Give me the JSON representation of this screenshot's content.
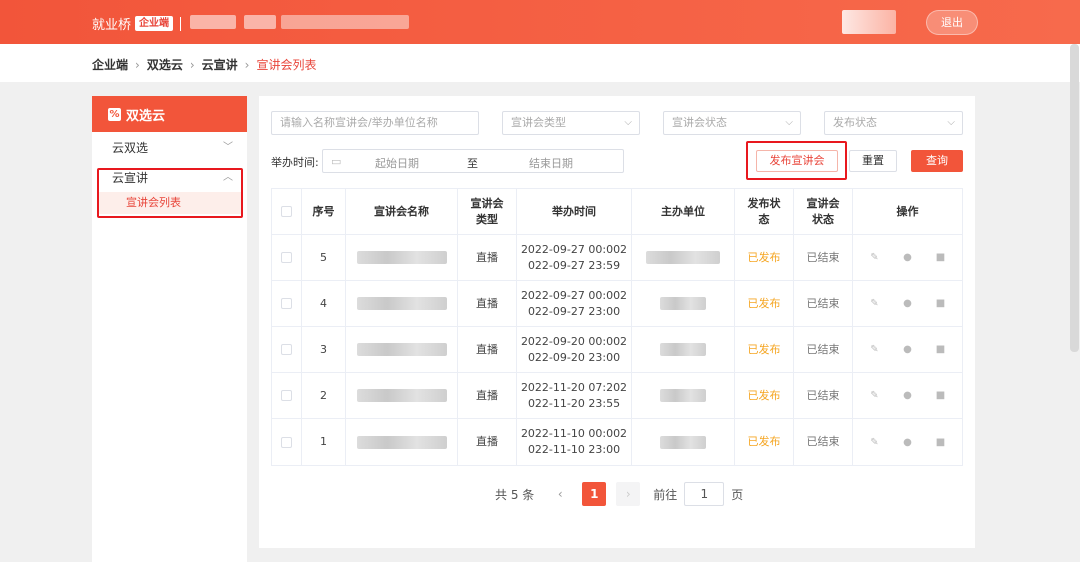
{
  "header": {
    "brand": "就业桥",
    "brand_tag": "企业端",
    "logout_label": "退出"
  },
  "breadcrumb": {
    "items": [
      "企业端",
      "双选云",
      "云宣讲"
    ],
    "current": "宣讲会列表"
  },
  "sidebar": {
    "title": "双选云",
    "logo_glyph": "%",
    "items": [
      {
        "label": "云双选",
        "chevron": "﹀"
      },
      {
        "label": "云宣讲",
        "chevron": "︿"
      }
    ],
    "sub_item": "宣讲会列表"
  },
  "filters": {
    "search_placeholder": "请输入名称宣讲会/举办单位名称",
    "type_placeholder": "宣讲会类型",
    "status_placeholder": "宣讲会状态",
    "publish_placeholder": "发布状态",
    "time_label": "举办时间:",
    "start_date": "起始日期",
    "to": "至",
    "end_date": "结束日期",
    "publish_button": "发布宣讲会",
    "reset_button": "重置",
    "query_button": "查询"
  },
  "table": {
    "columns": [
      "序号",
      "宣讲会名称",
      "宣讲会\n类型",
      "举办时间",
      "主办单位",
      "发布状\n态",
      "宣讲会\n状态",
      "操作"
    ],
    "rows": [
      {
        "no": "5",
        "type": "直播",
        "time1": "2022-09-27 00:002",
        "time2": "022-09-27 23:59",
        "publish": "已发布",
        "status": "已结束"
      },
      {
        "no": "4",
        "type": "直播",
        "time1": "2022-09-27 00:002",
        "time2": "022-09-27 23:00",
        "publish": "已发布",
        "status": "已结束"
      },
      {
        "no": "3",
        "type": "直播",
        "time1": "2022-09-20 00:002",
        "time2": "022-09-20 23:00",
        "publish": "已发布",
        "status": "已结束"
      },
      {
        "no": "2",
        "type": "直播",
        "time1": "2022-11-20 07:202",
        "time2": "022-11-20 23:55",
        "publish": "已发布",
        "status": "已结束"
      },
      {
        "no": "1",
        "type": "直播",
        "time1": "2022-11-10 00:002",
        "time2": "022-11-10 23:00",
        "publish": "已发布",
        "status": "已结束"
      }
    ],
    "op_icons": [
      "edit-icon",
      "user-icon",
      "download-icon"
    ]
  },
  "pagination": {
    "total": "共 5 条",
    "prev": "‹",
    "current": "1",
    "next": "›",
    "goto": "前往",
    "page_input": "1",
    "page_suffix": "页"
  },
  "colors": {
    "accent": "#f2553a",
    "highlight_border": "#e8181e",
    "published": "#f5a623"
  }
}
